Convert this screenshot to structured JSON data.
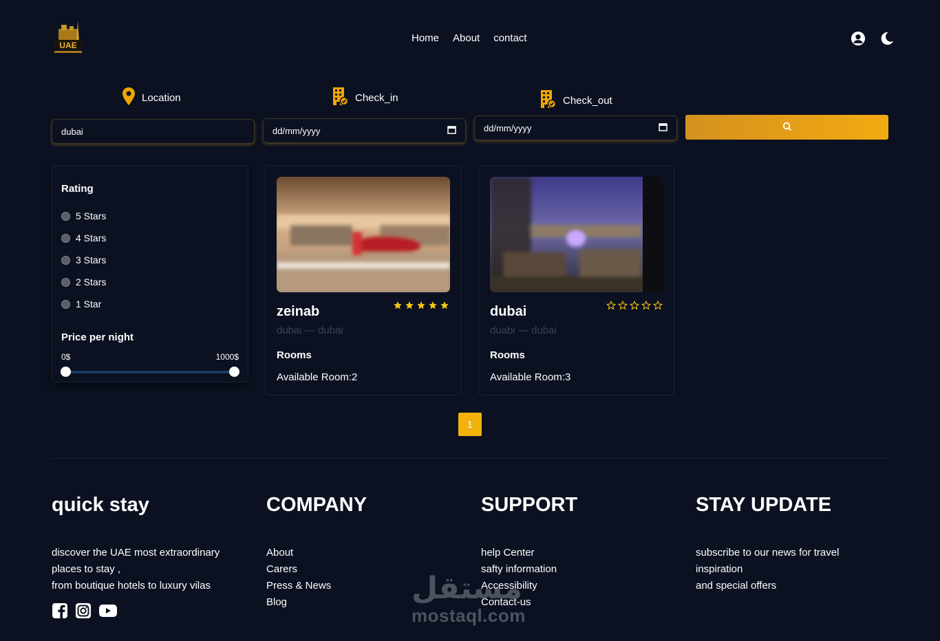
{
  "brand": {
    "logo_text": "UAE"
  },
  "nav": {
    "home": "Home",
    "about": "About",
    "contact": "contact"
  },
  "header_icons": [
    "user-circle-icon",
    "moon-icon"
  ],
  "search": {
    "location_label": "Location",
    "checkin_label": "Check_in",
    "checkout_label": "Check_out",
    "location_value": "dubai",
    "checkin_placeholder": "dd/mm/yyyy",
    "checkout_placeholder": "dd/mm/yyyy"
  },
  "filter": {
    "rating_title": "Rating",
    "ratings": [
      "5 Stars",
      "4 Stars",
      "3 Stars",
      "2 Stars",
      "1 Star"
    ],
    "price_title": "Price per night",
    "price_min": "0$",
    "price_max": "1000$",
    "price_range_fraction": [
      0,
      1
    ]
  },
  "hotels": [
    {
      "name": "zeinab",
      "stars": 5,
      "location": "dubai — dubai",
      "rooms_label": "Rooms",
      "available": "Available Room:2"
    },
    {
      "name": "dubai",
      "stars": 0,
      "location": "duabi — dubai",
      "rooms_label": "Rooms",
      "available": "Available Room:3"
    }
  ],
  "pagination": {
    "current": "1"
  },
  "footer": {
    "brand_title": "quick stay",
    "brand_text": [
      "discover the UAE most extraordinary",
      "places to stay ,",
      "from boutique hotels to luxury vilas"
    ],
    "company_title": "COMPANY",
    "company_links": [
      "About",
      "Carers",
      "Press & News",
      "Blog"
    ],
    "support_title": "SUPPORT",
    "support_links": [
      "help Center",
      "safty information",
      "Accessibility",
      "Contact-us"
    ],
    "update_title": "STAY UPDATE",
    "update_text": [
      "subscribe to our news for travel",
      "inspiration",
      "and special offers"
    ],
    "social": [
      "facebook-icon",
      "instagram-icon",
      "youtube-icon"
    ]
  },
  "watermark": {
    "arabic": "مستقل",
    "latin": "mostaql.com"
  },
  "colors": {
    "background": "#0b1120",
    "accent": "#f3b10c",
    "star": "#f5c518",
    "pin": "#f0a500"
  }
}
